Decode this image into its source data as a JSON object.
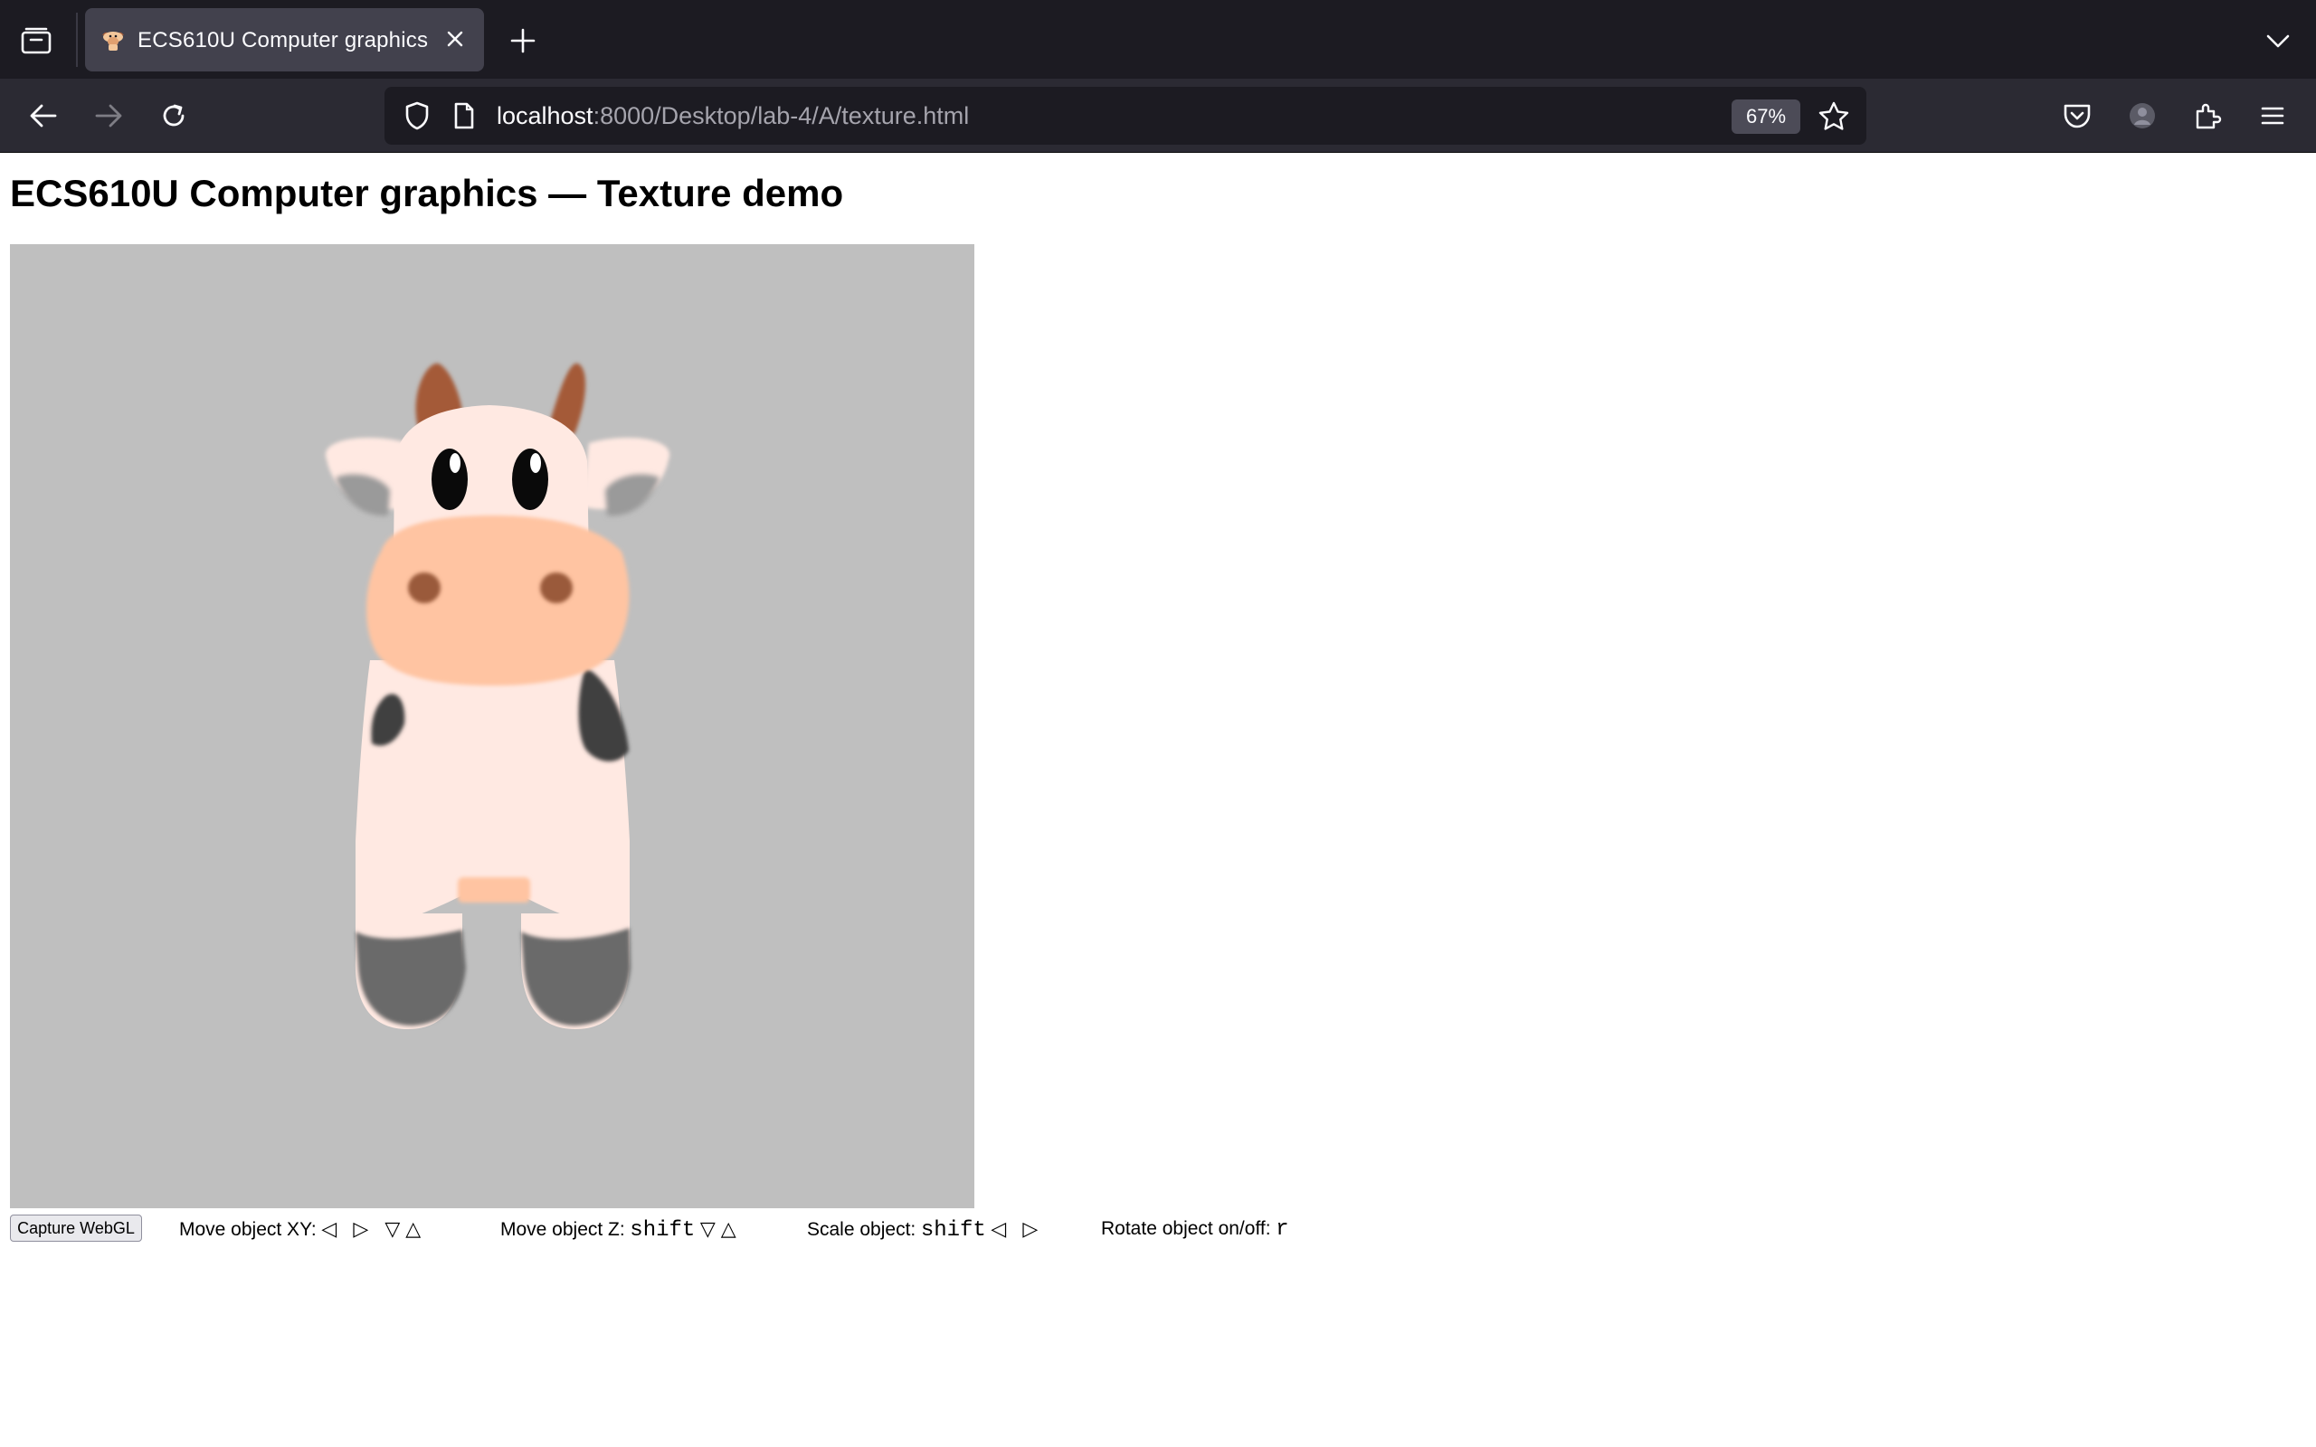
{
  "browser": {
    "tab": {
      "title": "ECS610U Computer graphics"
    },
    "url": {
      "host": "localhost",
      "rest": ":8000/Desktop/lab-4/A/texture.html"
    },
    "zoom": "67%"
  },
  "page": {
    "title": "ECS610U Computer graphics — Texture demo",
    "capture_button": "Capture WebGL",
    "controls": {
      "move_xy": {
        "label": "Move object XY:",
        "keys": "◁ ▷ ▽△"
      },
      "move_z": {
        "label": "Move object Z:",
        "key": "shift",
        "arrows": "▽△"
      },
      "scale": {
        "label": "Scale object:",
        "key": "shift",
        "arrows": "◁ ▷"
      },
      "rotate": {
        "label": "Rotate object on/off:",
        "key": "r"
      }
    }
  },
  "colors": {
    "canvas_bg": "#bfbfbf",
    "cow_body": "#ffe9e2",
    "cow_snout": "#ffc4a2",
    "cow_horn": "#a45a38",
    "cow_spot": "#404040",
    "cow_hoof": "#6a6a6a"
  }
}
